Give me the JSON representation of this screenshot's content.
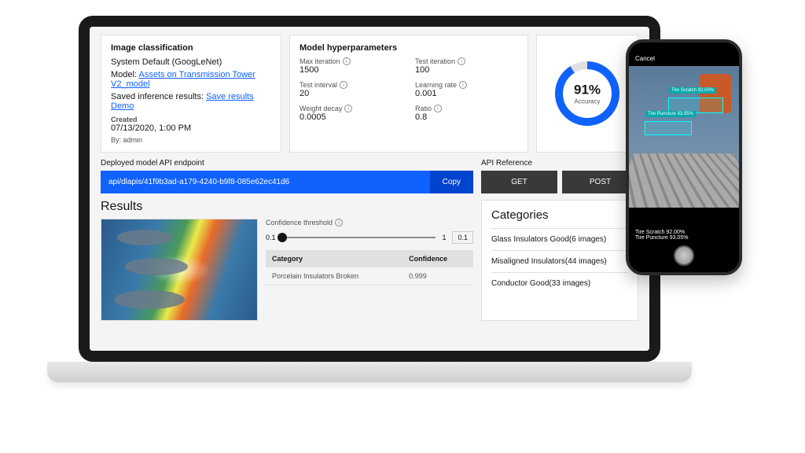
{
  "info": {
    "title": "Image classification",
    "system": "System Default (GoogLeNet)",
    "model_label": "Model:",
    "model_link": "Assets on Transmission Tower V2_model",
    "saved_label": "Saved inference results:",
    "saved_link": "Save results Demo",
    "created_label": "Created",
    "created_date": "07/13/2020, 1:00 PM",
    "by": "By: admin"
  },
  "hyper": {
    "title": "Model hyperparameters",
    "max_iter_label": "Max iteration",
    "max_iter": "1500",
    "test_iter_label": "Test iteration",
    "test_iter": "100",
    "test_interval_label": "Test interval",
    "test_interval": "20",
    "lr_label": "Learning rate",
    "lr": "0.001",
    "wd_label": "Weight decay",
    "wd": "0.0005",
    "ratio_label": "Ratio",
    "ratio": "0.8"
  },
  "accuracy": {
    "pct": "91%",
    "label": "Accuracy"
  },
  "api": {
    "deployed_label": "Deployed model API endpoint",
    "endpoint": "api/dlapis/41f9b3ad-a179-4240-b9f8-085e62ec41d6",
    "copy": "Copy",
    "ref_label": "API Reference",
    "get": "GET",
    "post": "POST"
  },
  "results": {
    "title": "Results",
    "conf_label": "Confidence threshold",
    "slider_min": "0.1",
    "slider_max": "1",
    "slider_val": "0.1",
    "col_category": "Category",
    "col_conf": "Confidence",
    "row_cat": "Porcelain Insulators Broken",
    "row_conf": "0.999"
  },
  "categories": {
    "title": "Categories",
    "items": [
      "Glass Insulators Good(6 images)",
      "Misaligned Insulators(44 images)",
      "Conductor Good(33 images)"
    ]
  },
  "phone": {
    "cancel": "Cancel",
    "det1": "Tire Scratch 92.00%",
    "det2": "Tire Puncture 93.05%",
    "res1": "Tire Scratch 92.00%",
    "res2": "Tire Puncture 93.05%"
  }
}
